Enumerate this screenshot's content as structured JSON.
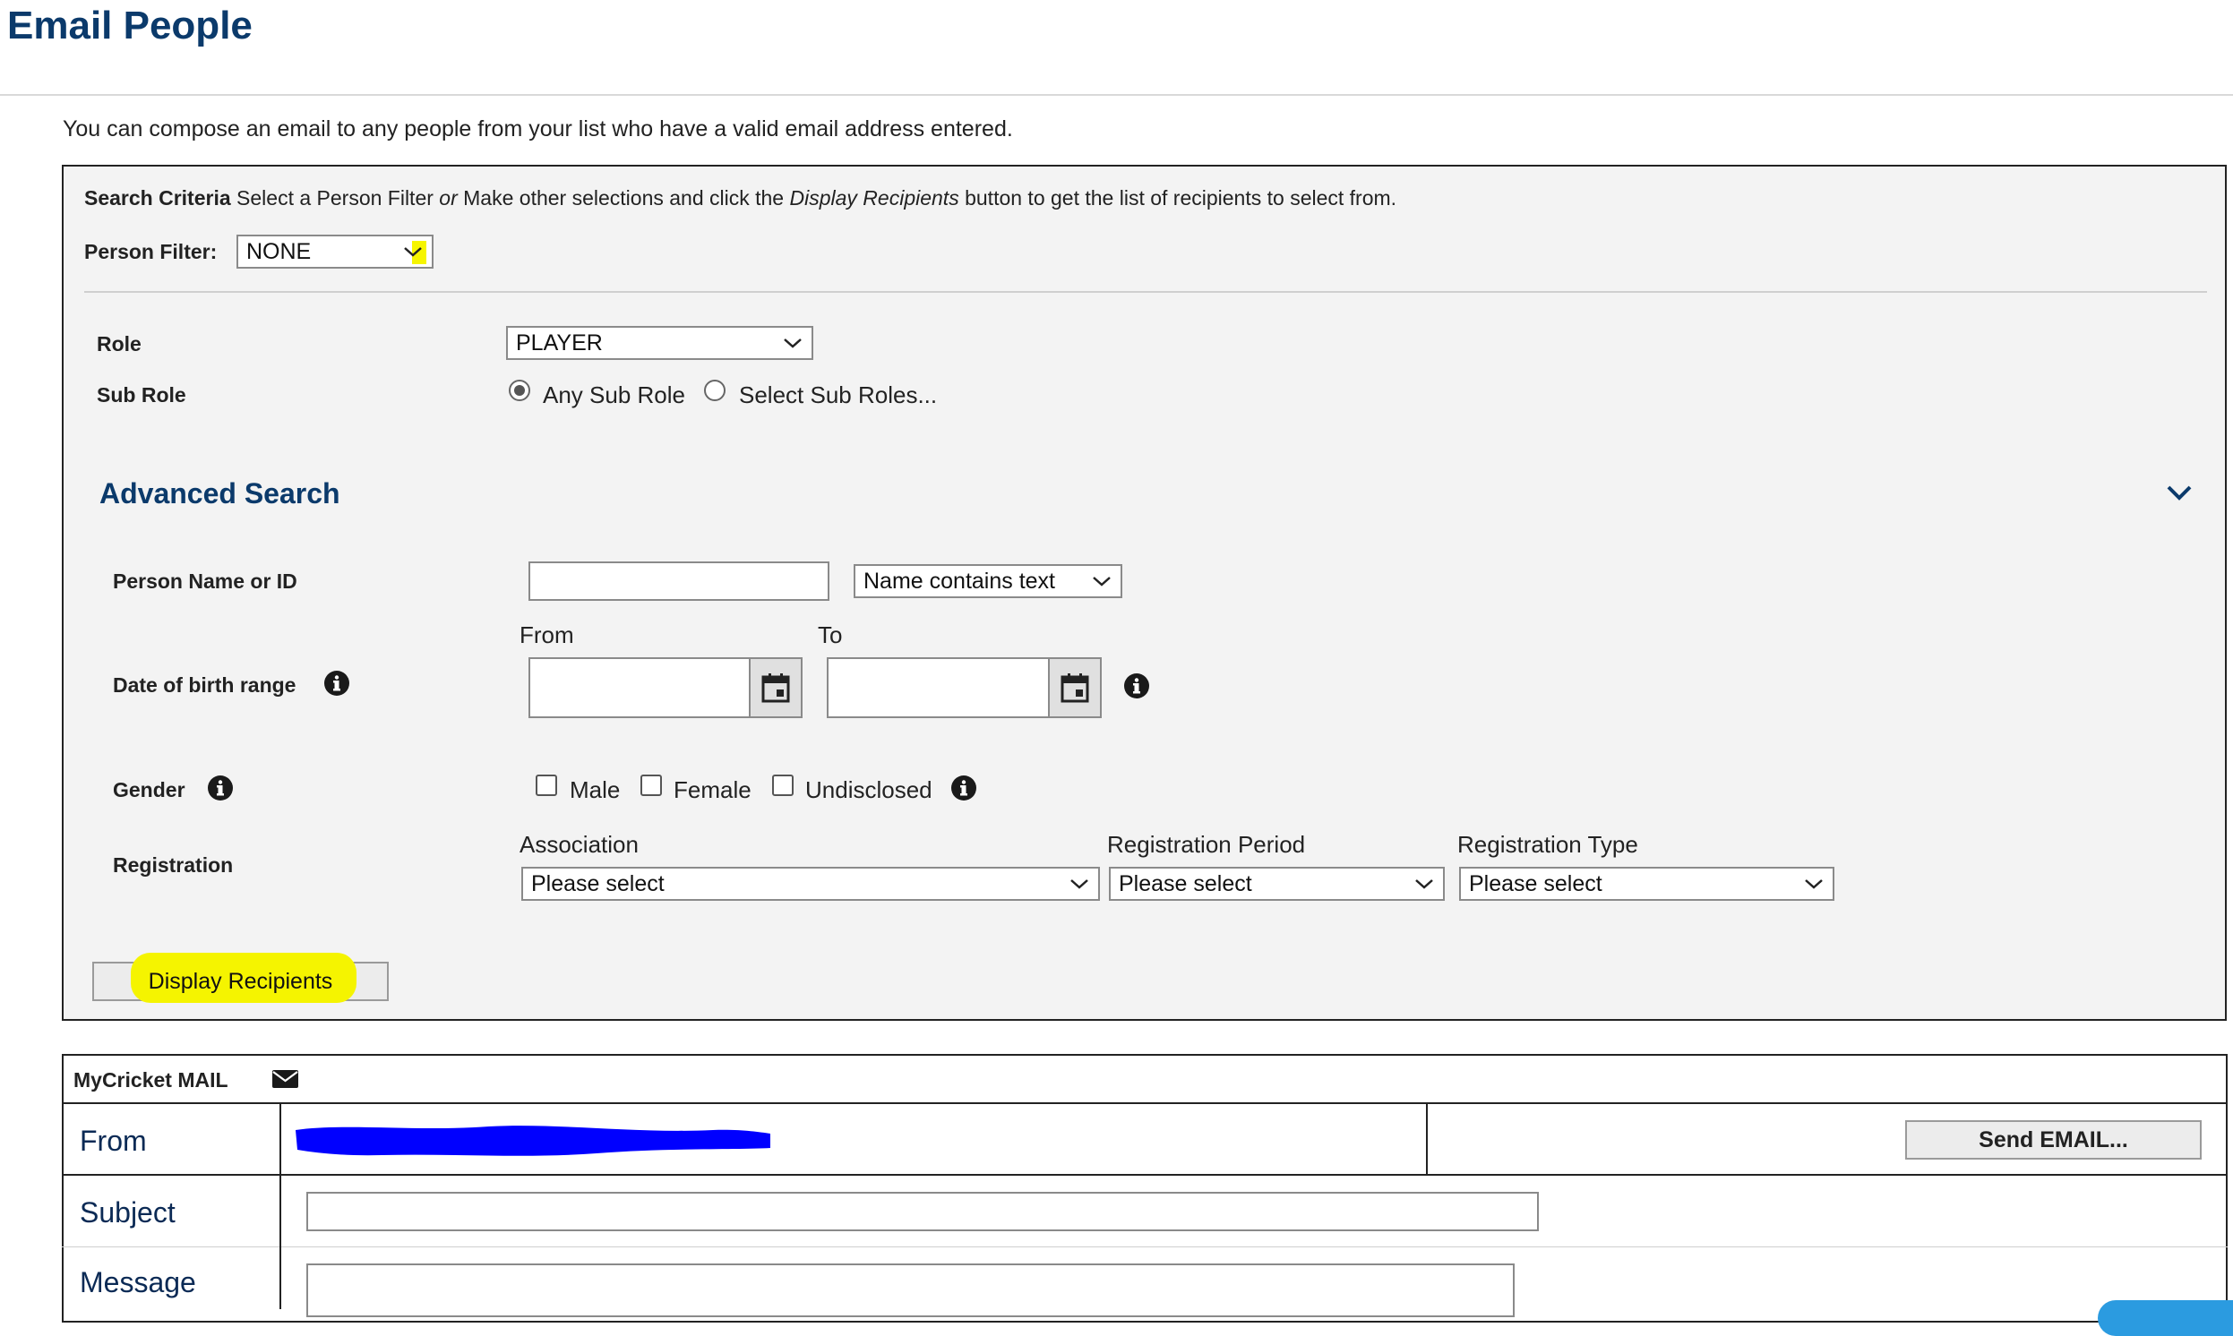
{
  "page": {
    "title": "Email People",
    "intro": "You can compose an email to any people from your list who have a valid email address entered."
  },
  "search": {
    "criteria_heading": "Search Criteria",
    "criteria_text_1": " Select a Person Filter ",
    "criteria_or": "or",
    "criteria_text_2": " Make other selections and click the ",
    "criteria_button_ref": "Display Recipients",
    "criteria_text_3": " button to get the list of recipients to select from.",
    "person_filter_label": "Person Filter:",
    "person_filter_value": "NONE",
    "role_label": "Role",
    "role_value": "PLAYER",
    "sub_role_label": "Sub Role",
    "sub_role_options": [
      "Any Sub Role",
      "Select Sub Roles..."
    ],
    "sub_role_selected": "Any Sub Role"
  },
  "advanced": {
    "title": "Advanced Search",
    "person_name_label": "Person Name or ID",
    "person_name_value": "",
    "name_match_value": "Name contains text",
    "dob_label": "Date of birth range",
    "from_label": "From",
    "to_label": "To",
    "from_value": "",
    "to_value": "",
    "gender_label": "Gender",
    "gender_options": [
      "Male",
      "Female",
      "Undisclosed"
    ],
    "registration_label": "Registration",
    "association_label": "Association",
    "association_value": "Please select",
    "period_label": "Registration Period",
    "period_value": "Please select",
    "type_label": "Registration Type",
    "type_value": "Please select",
    "display_button": "Display Recipients"
  },
  "mail": {
    "title": "MyCricket MAIL",
    "from_label": "From",
    "subject_label": "Subject",
    "message_label": "Message",
    "send_button": "Send EMAIL...",
    "subject_value": "",
    "message_value": ""
  },
  "colors": {
    "accent": "#0b3a6b",
    "highlight": "#f5f400",
    "redaction": "#0000ff"
  }
}
